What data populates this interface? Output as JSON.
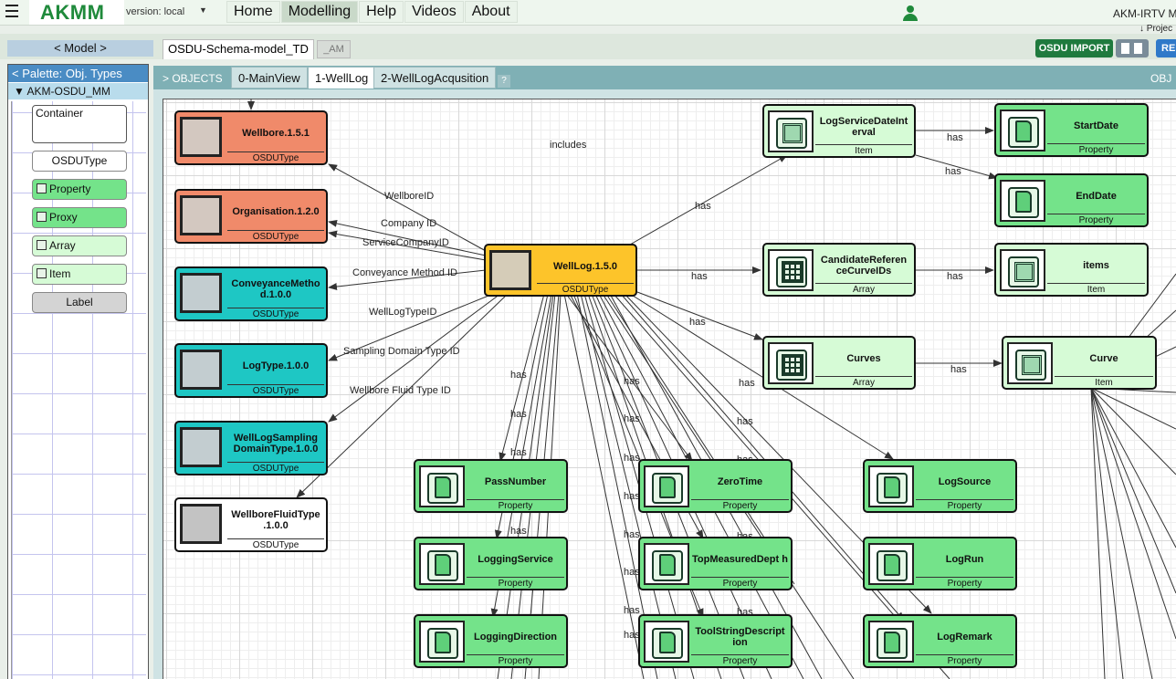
{
  "app": {
    "brand": "AKMM",
    "version": "version: local",
    "menu": [
      "Home",
      "Modelling",
      "Help",
      "Videos",
      "About"
    ],
    "active_menu": "Modelling",
    "right_title": "AKM-IRTV Mc",
    "right_sub": "↓ Projec"
  },
  "toolbar": {
    "model_button": "< Model >",
    "model_tabs": [
      "OSDU-Schema-model_TD",
      "_AM"
    ],
    "osdu_import": "OSDU IMPORT",
    "rel_label": "REL"
  },
  "palette": {
    "title": "< Palette: Obj. Types",
    "metamodel": "▼ AKM-OSDU_MM",
    "items": [
      {
        "label": "Container",
        "icon": "none"
      },
      {
        "label": "OSDUType",
        "icon": "none"
      },
      {
        "label": "Property",
        "icon": "property-icon"
      },
      {
        "label": "Proxy",
        "icon": "proxy-icon"
      },
      {
        "label": "Array",
        "icon": "array-icon"
      },
      {
        "label": "Item",
        "icon": "item-icon"
      },
      {
        "label": "Label",
        "icon": "none"
      }
    ]
  },
  "canvas": {
    "objects_label": "> OBJECTS",
    "objects_right": "OBJ",
    "view_tabs": [
      "0-MainView",
      "1-WellLog",
      "2-WellLogAcqusition"
    ],
    "active_view": "1-WellLog",
    "help": "?"
  },
  "nodes": [
    {
      "name": "Wellbore.1.5.1",
      "type": "OSDUType",
      "color": "#f08a6a"
    },
    {
      "name": "Organisation.1.2.0",
      "type": "OSDUType",
      "color": "#f08a6a"
    },
    {
      "name": "ConveyanceMetho d.1.0.0",
      "type": "OSDUType",
      "color": "#1ec7c4"
    },
    {
      "name": "LogType.1.0.0",
      "type": "OSDUType",
      "color": "#1ec7c4"
    },
    {
      "name": "WellLogSampling DomainType.1.0.0",
      "type": "OSDUType",
      "color": "#1ec7c4"
    },
    {
      "name": "WellboreFluidType .1.0.0",
      "type": "OSDUType",
      "color": "#ffffff"
    },
    {
      "name": "WellLog.1.5.0",
      "type": "OSDUType",
      "color": "#fdc42a"
    },
    {
      "name": "LogServiceDateInt erval",
      "type": "Item",
      "color": "#d6fbd6"
    },
    {
      "name": "StartDate",
      "type": "Property",
      "color": "#74e38a"
    },
    {
      "name": "EndDate",
      "type": "Property",
      "color": "#74e38a"
    },
    {
      "name": "CandidateReferen ceCurveIDs",
      "type": "Array",
      "color": "#d6fbd6"
    },
    {
      "name": "items",
      "type": "Item",
      "color": "#d6fbd6"
    },
    {
      "name": "Curves",
      "type": "Array",
      "color": "#d6fbd6"
    },
    {
      "name": "Curve",
      "type": "Item",
      "color": "#d6fbd6"
    },
    {
      "name": "PassNumber",
      "type": "Property",
      "color": "#74e38a"
    },
    {
      "name": "LoggingService",
      "type": "Property",
      "color": "#74e38a"
    },
    {
      "name": "LoggingDirection",
      "type": "Property",
      "color": "#74e38a"
    },
    {
      "name": "ZeroTime",
      "type": "Property",
      "color": "#74e38a"
    },
    {
      "name": "TopMeasuredDept h",
      "type": "Property",
      "color": "#74e38a"
    },
    {
      "name": "ToolStringDescript ion",
      "type": "Property",
      "color": "#74e38a"
    },
    {
      "name": "LogSource",
      "type": "Property",
      "color": "#74e38a"
    },
    {
      "name": "LogRun",
      "type": "Property",
      "color": "#74e38a"
    },
    {
      "name": "LogRemark",
      "type": "Property",
      "color": "#74e38a"
    }
  ],
  "edge_labels": [
    "includes",
    "WellboreID",
    "Company ID",
    "ServiceCompanyID",
    "Conveyance Method ID",
    "WellLogTypeID",
    "Sampling Domain Type ID",
    "Wellbore Fluid Type ID",
    "has",
    "has",
    "has",
    "has",
    "has",
    "has",
    "has",
    "has",
    "has",
    "has",
    "has",
    "has",
    "has",
    "has",
    "has",
    "has",
    "has",
    "has",
    "has",
    "has",
    "has",
    "has",
    "has",
    "has",
    "has",
    "has",
    "has",
    "has",
    "has",
    "has",
    "has",
    "has",
    "has",
    "has"
  ]
}
